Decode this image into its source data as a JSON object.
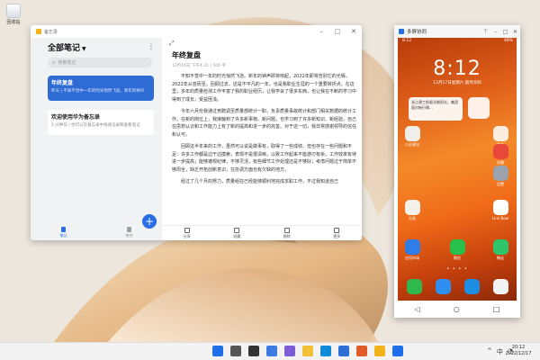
{
  "desktop": {
    "icon_label": "回收站"
  },
  "notes": {
    "window_title": "备忘录",
    "list_title": "全部笔记",
    "search_placeholder": "搜索笔记",
    "cards": [
      {
        "title": "年终复盘",
        "summary": "昨天 | 不知不觉中一年的时光悄然飞逝。新年的钟声"
      },
      {
        "title": "欢迎使用华为备忘录",
        "summary": "5 分钟前 | 你可以在备忘录中快速记录和查看笔记"
      }
    ],
    "left_nav": {
      "notes": "笔记",
      "todo": "待办"
    },
    "doc_title": "年终复盘",
    "doc_meta": "12月16日 下午4:31 | 500 字",
    "doc_paragraphs": [
      "不知不觉中一年的时光悄然飞逝。新年的钟声即将响起，2022年即将告别它的光辉，2022年从容而至。回顾过去，这是不平凡的一年，也是我职业生涯的一个重要转折点。在这里，多年的质量检测工作丰富了我的职业经历，让我学会了很多东西，也让我在不断的学习中得到了成长，受益匪浅。",
      "今年六月份我通过竞聘调至质量部统计一职，负责质量事故统计和部门相关数据的统计工作。在新的岗位上，我接触到了许多新事物、新问题，也学习到了许多新知识、新经验，自己在思想认识和工作能力上有了新的提高和进一步的完善。对于这一切，我非常感谢领导的信任和认可。",
      "回顾这半年来的工作，虽然可以说是做事有，取得了一些成绩，但也存在一些问题和不足：许多工作都是边干边摸索，表现不是很清晰，以致工作起来不能游刃有余，工作效率有待进一步提高；能够遵规纪律，不够灵活，有些细节工作处理还是不够好；考虑问题过于简单不够周全，缺乏开拓创新意识，在协调方面也有欠缺的地方。",
      "经过了几个月的努力，质量组在已经能够顺利地完成本职工作，不过我知道自己"
    ],
    "bottom_actions": [
      "分享",
      "收藏",
      "删除",
      "更多"
    ]
  },
  "phone": {
    "window_title": "多屏协同",
    "status_left": "8:12",
    "status_right": "48%",
    "time": "8:12",
    "date": "12月17日星期六 腊月廿四",
    "widget_note_text": "浙江建工前驱试制阳光，集团面对新行情…",
    "apps": [
      {
        "name": "小艺建议"
      },
      {
        "name": "工具"
      },
      {
        "name": "设置"
      },
      {
        "name": "花瓣"
      },
      {
        "name": "分类"
      },
      {
        "name": "Link Now"
      },
      {
        "name": "应用市场"
      },
      {
        "name": "微信"
      },
      {
        "name": "畅连"
      }
    ],
    "dock": [
      {
        "name": "电话"
      },
      {
        "name": "信息"
      },
      {
        "name": "浏览器"
      },
      {
        "name": "相机"
      }
    ],
    "nav": {
      "back": "◁",
      "home": "○",
      "recents": "□"
    }
  },
  "taskbar": {
    "clock_time": "20:12",
    "clock_date": "2022/12/17",
    "tray": [
      "^",
      "中",
      "◔"
    ]
  },
  "colors": {
    "accent_blue": "#2f6bd4",
    "fab_blue": "#2a6ee6",
    "wallpaper_orange": "#e0601a"
  }
}
